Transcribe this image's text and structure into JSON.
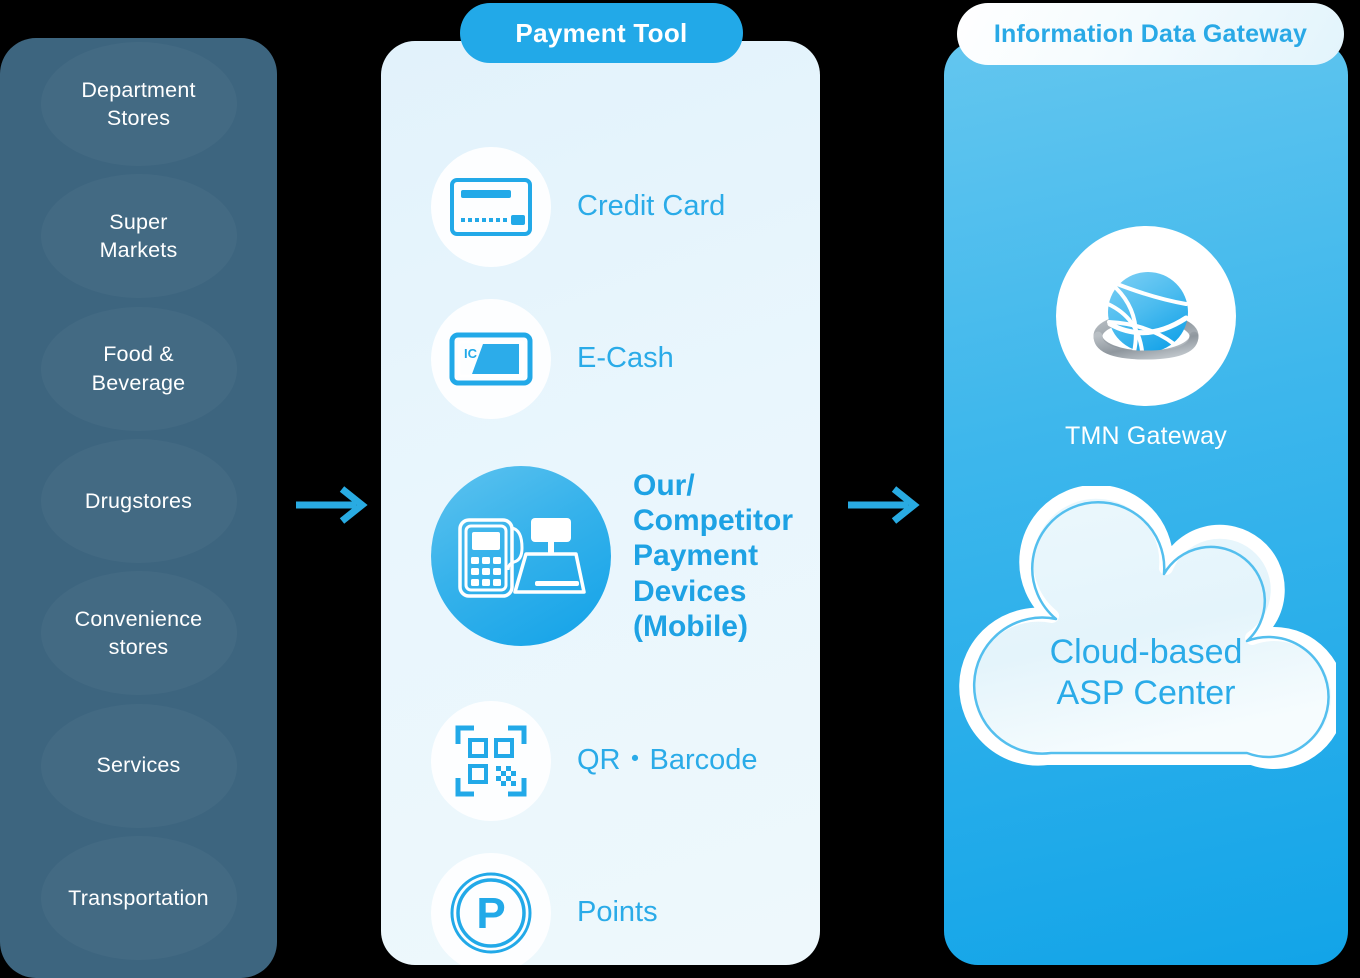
{
  "diagram": {
    "title": "Payment flow: merchant channels to payment tools to information data gateway",
    "colors": {
      "merchant_panel_bg": "#3d657f",
      "payment_panel_bg": "#e6f4fc",
      "gateway_panel_bg": "#36b4ec",
      "accent_blue": "#2aabe8",
      "header_pill_blue": "#22a9e8",
      "arrow_blue": "#29abe2",
      "text_white": "#ffffff"
    }
  },
  "merchants": {
    "panel_name": "merchant-channels",
    "items": [
      {
        "label": "Department\nStores"
      },
      {
        "label": "Super\nMarkets"
      },
      {
        "label": "Food &\nBeverage"
      },
      {
        "label": "Drugstores"
      },
      {
        "label": "Convenience\nstores"
      },
      {
        "label": "Services"
      },
      {
        "label": "Transportation"
      }
    ]
  },
  "arrows": [
    {
      "name": "arrow-merchants-to-payment",
      "direction": "right",
      "color": "#29abe2"
    },
    {
      "name": "arrow-payment-to-gateway",
      "direction": "right",
      "color": "#29abe2"
    }
  ],
  "payment_tool": {
    "header": "Payment Tool",
    "items": [
      {
        "label": "Credit Card",
        "icon": "credit-card-icon",
        "emphasis": false
      },
      {
        "label": "E-Cash",
        "icon": "ic-card-icon",
        "emphasis": false
      },
      {
        "label": "Our/\nCompetitor\nPayment\nDevices\n(Mobile)",
        "icon": "payment-terminal-register-icon",
        "emphasis": true
      },
      {
        "label": "QR・Barcode",
        "icon": "qr-barcode-icon",
        "emphasis": false
      },
      {
        "label": "Points",
        "icon": "points-p-icon",
        "emphasis": false
      }
    ],
    "icon_text": {
      "ic_chip_label": "IC",
      "points_letter": "P"
    }
  },
  "gateway": {
    "header": "Information Data Gateway",
    "tmn": {
      "label": "TMN Gateway",
      "icon": "tmn-globe-logo-icon"
    },
    "cloud": {
      "label": "Cloud-based\nASP Center",
      "icon": "cloud-icon"
    }
  }
}
